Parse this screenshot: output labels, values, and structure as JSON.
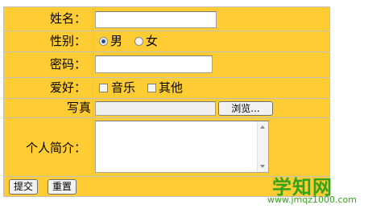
{
  "form": {
    "name_label": "姓名：",
    "name_value": "",
    "gender_label": "性别：",
    "gender_options": [
      "男",
      "女"
    ],
    "gender_selected": "男",
    "password_label": "密码：",
    "password_value": "",
    "hobby_label": "爱好：",
    "hobby_options": [
      "音乐",
      "其他"
    ],
    "photo_label": "写真",
    "photo_value": "",
    "browse_label": "浏览...",
    "bio_label": "个人简介：",
    "bio_value": "",
    "submit_label": "提交",
    "reset_label": "重置"
  },
  "watermark": {
    "logo": "学知网",
    "url": "www.jmqz1000.com"
  },
  "colors": {
    "cell_bg": "#ffcc33",
    "border": "#c0c0c0",
    "watermark": "#36a21b"
  }
}
